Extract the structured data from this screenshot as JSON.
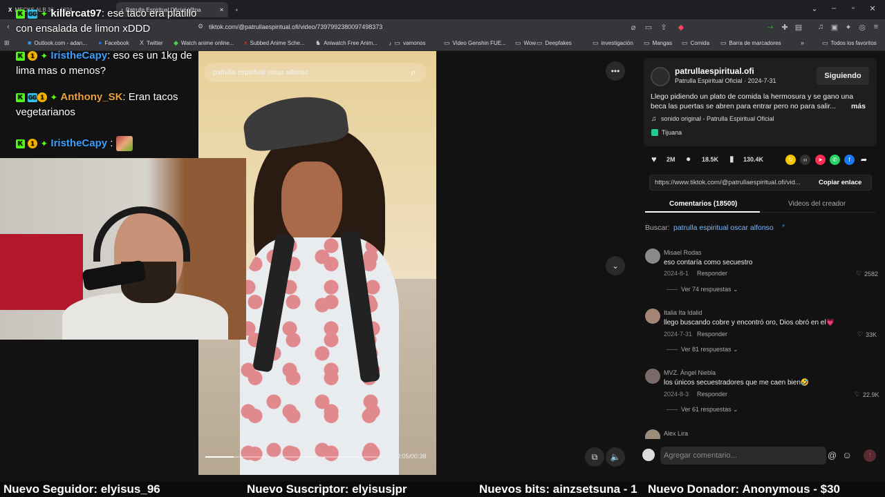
{
  "browser": {
    "tabs": [
      {
        "label": "MECKS ALB 36 ...1024",
        "active": false
      },
      {
        "label": "Patrulla Espiritual Oficial (@pa",
        "active": true
      }
    ],
    "new_tab": "+",
    "url": "tiktok.com/@patrullaespiritual.ofi/video/7397992380097498373",
    "bookmarks": [
      "Outlook.com - adan...",
      "Facebook",
      "Twitter",
      "Watch anime online...",
      "Subbed Anime Sche...",
      "Aniwatch Free Anim...",
      "vamonos",
      "Video Genshin FUE...",
      "Wow",
      "Deepfakes",
      "investigación",
      "Mangas",
      "Comida",
      "Barra de marcadores"
    ],
    "all_favorites": "Todos los favoritos"
  },
  "chat": [
    {
      "user": "killercat97",
      "user_color": "#ffffff",
      "text": ": ese taco era platillo con ensalada de limon xDDD"
    },
    {
      "user": "IristheCapy",
      "user_color": "#3aa0ff",
      "text": ": eso es un 1kg de lima mas o menos?"
    },
    {
      "user": "Anthony_SK",
      "user_color": "#f0a13a",
      "text": ": Eran tacos vegetarianos"
    },
    {
      "user": "IristheCapy",
      "user_color": "#3aa0ff",
      "text": " :"
    }
  ],
  "video": {
    "search_text": "patrulla espiritual oscar alfonso",
    "time": "00:05/00:38",
    "progress": 0.16
  },
  "creator": {
    "handle": "patrullaespiritual.ofi",
    "meta": "Patrulla Espiritual Oficial · 2024-7-31",
    "follow_label": "Siguiendo",
    "description_1": "Llego pidiendo un plato de comida la hermosura y se gano una",
    "description_2": "beca las puertas se abren para entrar pero no para salir...",
    "more": "más",
    "sound": "sonido original - Patrulla Espiritual Oficial",
    "location": "Tijuana"
  },
  "stats": {
    "likes": "2M",
    "comments": "18.5K",
    "saves": "130.4K"
  },
  "share": {
    "link": "https://www.tiktok.com/@patrullaespiritual.ofi/vid...",
    "copy_label": "Copiar enlace"
  },
  "tabs": {
    "comments": "Comentarios (18500)",
    "creator_videos": "Videos del creador"
  },
  "search": {
    "prefix": "Buscar:",
    "query": "patrulla espiritual oscar alfonso"
  },
  "comments": [
    {
      "name": "Misael Rodas",
      "text": "eso contaría como secuestro",
      "date": "2024-8-1",
      "reply": "Responder",
      "likes": "2582",
      "more": "Ver 74 respuestas"
    },
    {
      "name": "Italia Ita Idalid",
      "text": "llego buscando cobre y encontró oro, Dios obró en el💗",
      "date": "2024-7-31",
      "reply": "Responder",
      "likes": "33K",
      "more": "Ver 81 respuestas"
    },
    {
      "name": "MVZ. Ángel Niebla",
      "text": "los únicos secuestradores que me caen bien🤣",
      "date": "2024-8-3",
      "reply": "Responder",
      "likes": "22.9K",
      "more": "Ver 61 respuestas"
    },
    {
      "name": "Alex Lira"
    }
  ],
  "comment_input": {
    "placeholder": "Agregar comentario..."
  },
  "ticker": {
    "follower": "Nuevo Seguidor: elyisus_96",
    "subscriber": "Nuevo Suscriptor: elyisusjpr",
    "bits": "Nuevos bits: ainzsetsuna - 1",
    "donor": "Nuevo Donador: Anonymous - $30"
  },
  "colors": {
    "kick_green": "#53fc18",
    "tiktok_red": "#fe2c55",
    "panel_bg": "#121212"
  }
}
